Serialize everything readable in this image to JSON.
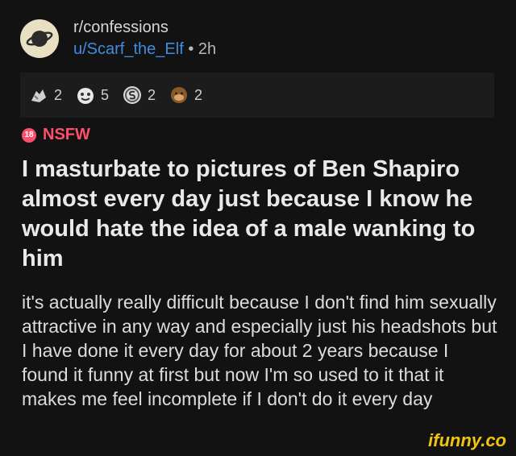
{
  "post": {
    "subreddit": "r/confessions",
    "username": "u/Scarf_the_Elf",
    "separator": "•",
    "age": "2h",
    "flair": "NSFW",
    "flair_badge": "18",
    "title": "I masturbate to pictures of Ben Shapiro almost every day just because I know he would hate the idea of a male wanking to him",
    "body": "it's actually really difficult because I don't find him sexually attractive in any way and especially just his headshots but I have done it every day for about 2 years because I found it funny at first but now I'm so used to it that it makes me feel incomplete if I don't do it every day"
  },
  "awards": [
    {
      "icon": "hands-award-icon",
      "count": "2"
    },
    {
      "icon": "face-award-icon",
      "count": "5"
    },
    {
      "icon": "silver-coin-award-icon",
      "count": "2"
    },
    {
      "icon": "ape-award-icon",
      "count": "2"
    }
  ],
  "watermark": "ifunny.co",
  "colors": {
    "background": "#121212",
    "username": "#3f8ce0",
    "nsfw": "#ff4f6d",
    "watermark": "#f1c40f"
  }
}
